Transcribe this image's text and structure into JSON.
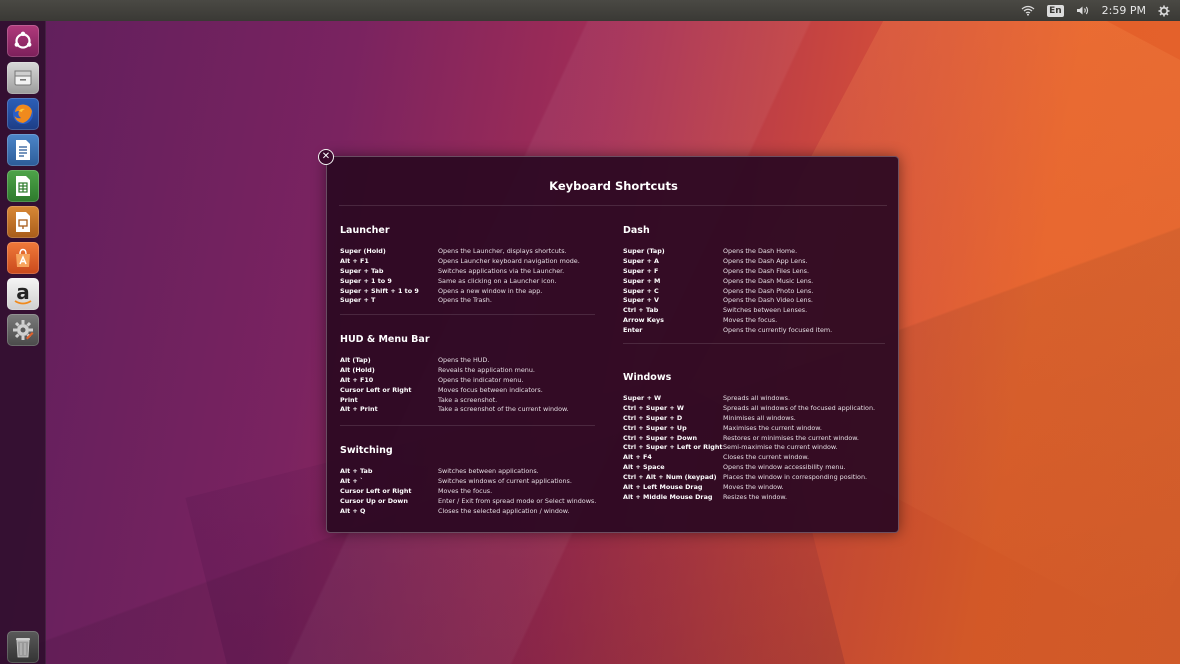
{
  "top_panel": {
    "wifi_icon": "wifi-icon",
    "keyboard_layout": "En",
    "volume_icon": "volume-icon",
    "clock": "2:59 PM",
    "settings_icon": "gear-icon"
  },
  "launcher": {
    "items": [
      {
        "name": "ubuntu-dash-icon"
      },
      {
        "name": "files-icon"
      },
      {
        "name": "firefox-icon"
      },
      {
        "name": "libreoffice-writer-icon"
      },
      {
        "name": "libreoffice-calc-icon"
      },
      {
        "name": "libreoffice-impress-icon"
      },
      {
        "name": "ubuntu-software-icon"
      },
      {
        "name": "amazon-icon"
      },
      {
        "name": "system-settings-icon"
      },
      {
        "name": "trash-icon"
      }
    ],
    "amazon_letter": "a"
  },
  "overlay": {
    "close_glyph": "✕",
    "title": "Keyboard Shortcuts",
    "sections": {
      "launcher": {
        "title": "Launcher",
        "rows": [
          {
            "key": "Super (Hold)",
            "desc": "Opens the Launcher, displays shortcuts."
          },
          {
            "key": "Alt + F1",
            "desc": "Opens Launcher keyboard navigation mode."
          },
          {
            "key": "Super + Tab",
            "desc": "Switches applications via the Launcher."
          },
          {
            "key": "Super + 1 to 9",
            "desc": "Same as clicking on a Launcher icon."
          },
          {
            "key": "Super + Shift + 1 to 9",
            "desc": "Opens a new window in the app."
          },
          {
            "key": "Super + T",
            "desc": "Opens the Trash."
          }
        ]
      },
      "hud": {
        "title": "HUD & Menu Bar",
        "rows": [
          {
            "key": "Alt (Tap)",
            "desc": "Opens the HUD."
          },
          {
            "key": "Alt (Hold)",
            "desc": "Reveals the application menu."
          },
          {
            "key": "Alt + F10",
            "desc": "Opens the indicator menu."
          },
          {
            "key": "Cursor Left or Right",
            "desc": "Moves focus between indicators."
          },
          {
            "key": "Print",
            "desc": "Take a screenshot."
          },
          {
            "key": "Alt + Print",
            "desc": "Take a screenshot of the current window."
          }
        ]
      },
      "switching": {
        "title": "Switching",
        "rows": [
          {
            "key": "Alt + Tab",
            "desc": "Switches between applications."
          },
          {
            "key": "Alt + `",
            "desc": "Switches windows of current applications."
          },
          {
            "key": "Cursor Left or Right",
            "desc": "Moves the focus."
          },
          {
            "key": "Cursor Up or Down",
            "desc": "Enter / Exit from spread mode or Select windows."
          },
          {
            "key": "Alt + Q",
            "desc": "Closes the selected application / window."
          }
        ]
      },
      "dash": {
        "title": "Dash",
        "rows": [
          {
            "key": "Super (Tap)",
            "desc": "Opens the Dash Home."
          },
          {
            "key": "Super + A",
            "desc": "Opens the Dash App Lens."
          },
          {
            "key": "Super + F",
            "desc": "Opens the Dash Files Lens."
          },
          {
            "key": "Super + M",
            "desc": "Opens the Dash Music Lens."
          },
          {
            "key": "Super + C",
            "desc": "Opens the Dash Photo Lens."
          },
          {
            "key": "Super + V",
            "desc": "Opens the Dash Video Lens."
          },
          {
            "key": "Ctrl + Tab",
            "desc": "Switches between Lenses."
          },
          {
            "key": "Arrow Keys",
            "desc": "Moves the focus."
          },
          {
            "key": "Enter",
            "desc": "Opens the currently focused item."
          }
        ]
      },
      "windows": {
        "title": "Windows",
        "rows": [
          {
            "key": "Super + W",
            "desc": "Spreads all windows."
          },
          {
            "key": "Ctrl + Super + W",
            "desc": "Spreads all windows of the focused application."
          },
          {
            "key": "Ctrl + Super + D",
            "desc": "Minimises all windows."
          },
          {
            "key": "Ctrl + Super + Up",
            "desc": "Maximises the current window."
          },
          {
            "key": "Ctrl + Super + Down",
            "desc": "Restores or minimises the current window."
          },
          {
            "key": "Ctrl + Super + Left or Right",
            "desc": "Semi-maximise the current window."
          },
          {
            "key": "Alt + F4",
            "desc": "Closes the current window."
          },
          {
            "key": "Alt + Space",
            "desc": "Opens the window accessibility menu."
          },
          {
            "key": "Ctrl + Alt + Num (keypad)",
            "desc": "Places the window in corresponding position."
          },
          {
            "key": "Alt + Left Mouse Drag",
            "desc": "Moves the window."
          },
          {
            "key": "Alt + Middle Mouse Drag",
            "desc": "Resizes the window."
          }
        ]
      }
    }
  }
}
